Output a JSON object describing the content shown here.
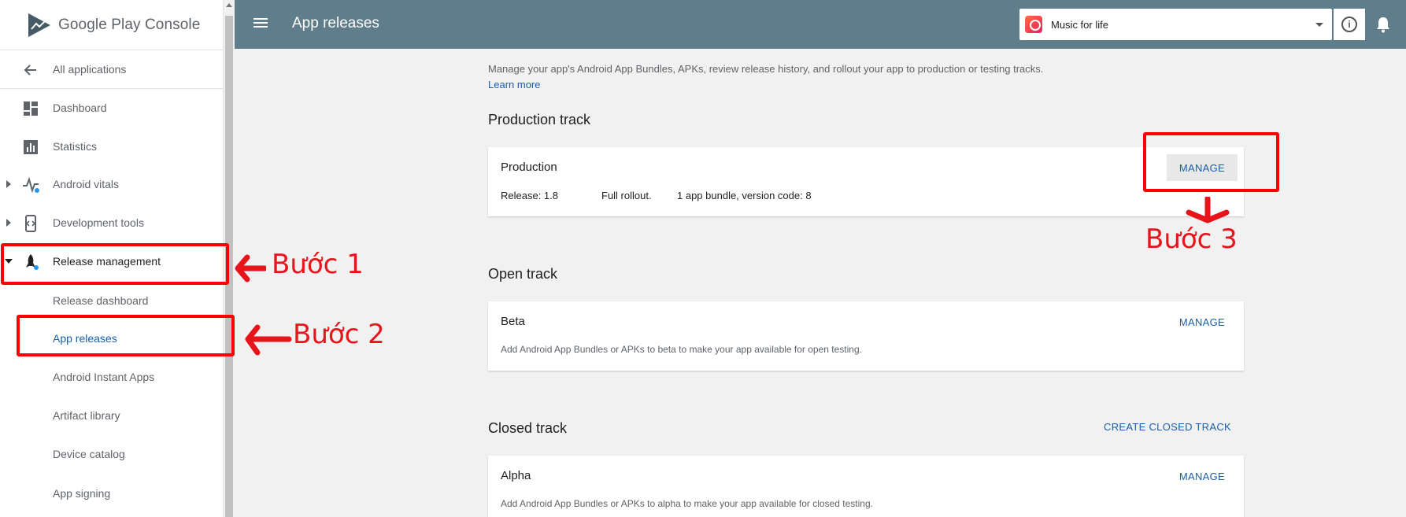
{
  "sidebar": {
    "logo_text": "Google Play Console",
    "back_label": "All applications",
    "items": [
      {
        "label": "Dashboard",
        "icon": "dashboard-icon"
      },
      {
        "label": "Statistics",
        "icon": "bar-chart-icon"
      },
      {
        "label": "Android vitals",
        "icon": "vitals-pulse-icon"
      },
      {
        "label": "Development tools",
        "icon": "code-tools-icon"
      },
      {
        "label": "Release management",
        "icon": "rocket-icon"
      }
    ],
    "sub_items": [
      "Release dashboard",
      "App releases",
      "Android Instant Apps",
      "Artifact library",
      "Device catalog",
      "App signing"
    ]
  },
  "header": {
    "title": "App releases",
    "app_name": "Music for life",
    "info": "i"
  },
  "main": {
    "intro": "Manage your app's Android App Bundles, APKs, review release history, and rollout your app to production or testing tracks.",
    "learn_more": "Learn more",
    "production": {
      "heading": "Production track",
      "card_title": "Production",
      "release": "Release: 1.8",
      "rollout": "Full rollout.",
      "bundle": "1 app bundle, version code: 8",
      "manage": "MANAGE"
    },
    "open": {
      "heading": "Open track",
      "card_title": "Beta",
      "desc": "Add Android App Bundles or APKs to beta to make your app available for open testing.",
      "manage": "MANAGE"
    },
    "closed": {
      "heading": "Closed track",
      "create": "CREATE CLOSED TRACK",
      "card_title": "Alpha",
      "desc": "Add Android App Bundles or APKs to alpha to make your app available for closed testing.",
      "manage": "MANAGE"
    }
  },
  "annotations": {
    "step1": "Bước 1",
    "step2": "Bước 2",
    "step3": "Bước 3",
    "color": "#ff0000"
  }
}
